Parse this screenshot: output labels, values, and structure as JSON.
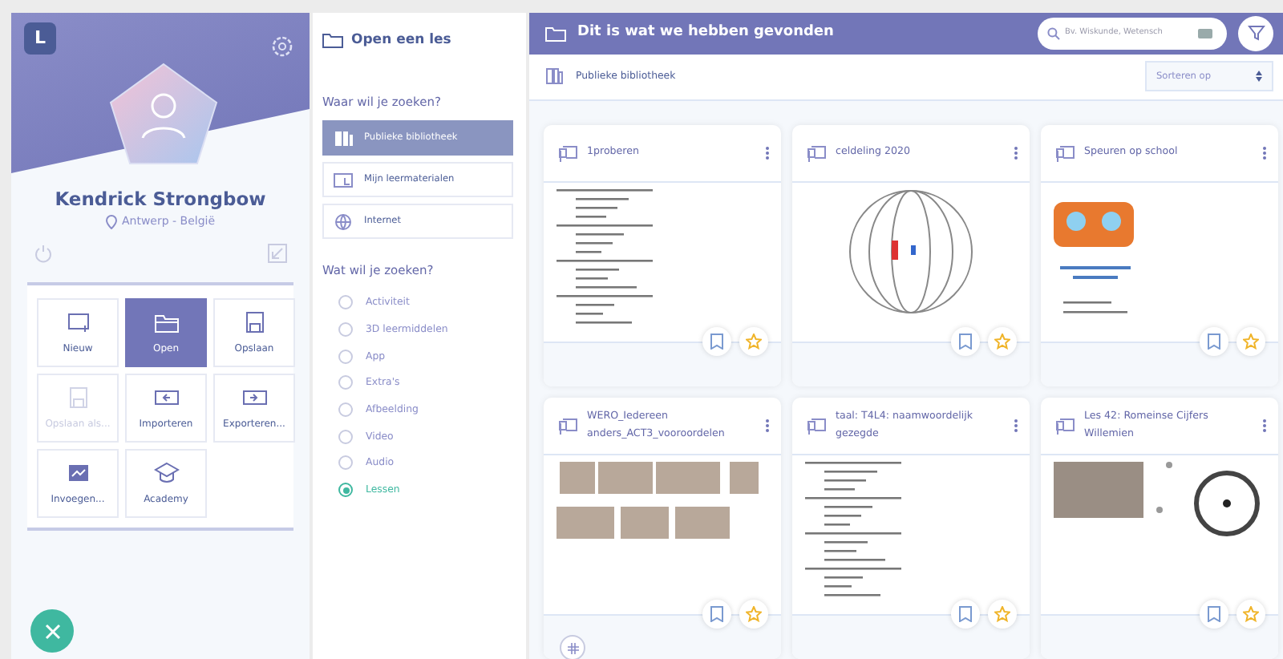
{
  "profile": {
    "logo": "L",
    "name": "Kendrick Strongbow",
    "location": "Antwerp - België"
  },
  "menu_tiles": [
    {
      "kind": "new",
      "label": "Nieuw",
      "selected": false,
      "disabled": false
    },
    {
      "kind": "open",
      "label": "Open",
      "selected": true,
      "disabled": false
    },
    {
      "kind": "save",
      "label": "Opslaan",
      "selected": false,
      "disabled": false
    },
    {
      "kind": "save",
      "label": "Opslaan als...",
      "selected": false,
      "disabled": true
    },
    {
      "kind": "import",
      "label": "Importeren",
      "selected": false,
      "disabled": false
    },
    {
      "kind": "export",
      "label": "Exporteren...",
      "selected": false,
      "disabled": false
    },
    {
      "kind": "embed",
      "label": "Invoegen...",
      "selected": false,
      "disabled": false
    },
    {
      "kind": "academy",
      "label": "Academy",
      "selected": false,
      "disabled": false
    }
  ],
  "open_panel": {
    "title": "Open een les",
    "where_heading": "Waar wil je zoeken?",
    "sources": [
      {
        "kind": "library",
        "label": "Publieke bibliotheek",
        "selected": true
      },
      {
        "kind": "materials",
        "label": "Mijn leermaterialen",
        "selected": false
      },
      {
        "kind": "internet",
        "label": "Internet",
        "selected": false
      }
    ],
    "what_heading": "Wat wil je zoeken?",
    "types": [
      {
        "label": "Activiteit",
        "selected": false
      },
      {
        "label": "3D leermiddelen",
        "selected": false
      },
      {
        "label": "App",
        "selected": false
      },
      {
        "label": "Extra's",
        "selected": false
      },
      {
        "label": "Afbeelding",
        "selected": false
      },
      {
        "label": "Video",
        "selected": false
      },
      {
        "label": "Audio",
        "selected": false
      },
      {
        "label": "Lessen",
        "selected": true
      }
    ]
  },
  "results": {
    "title": "Dit is wat we hebben gevonden",
    "search": {
      "placeholder": "Bv. Wiskunde, Wetensch"
    },
    "breadcrumb": "Publieke bibliotheek",
    "sort": "Sorteren op",
    "cards": [
      {
        "title": "1proberen",
        "kind": "document",
        "tag_button": false
      },
      {
        "title": "celdeling 2020",
        "kind": "diagram",
        "tag_button": false
      },
      {
        "title": "Speuren op school",
        "kind": "poster",
        "tag_button": false
      },
      {
        "title": "WERO_Iedereen anders_ACT3_vooroordelen",
        "kind": "photos",
        "tag_button": true
      },
      {
        "title": "taal: T4L4: naamwoordelijk gezegde",
        "kind": "document",
        "tag_button": false
      },
      {
        "title": "Les 42: Romeinse Cijfers Willemien",
        "kind": "photo-clock",
        "tag_button": false
      }
    ]
  }
}
